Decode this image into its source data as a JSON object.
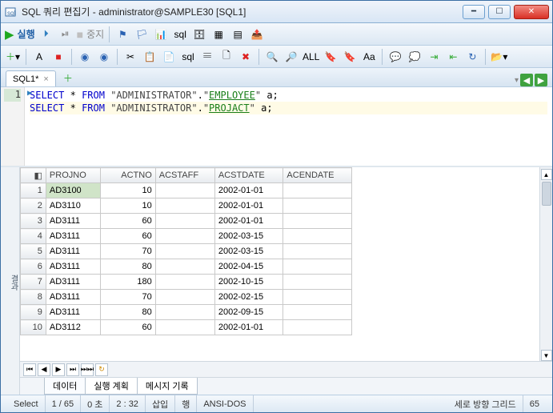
{
  "window": {
    "title": "SQL 쿼리 편집기 - administrator@SAMPLE30 [SQL1]"
  },
  "toolbar1": {
    "run_label": "실행",
    "stop_label": "중지"
  },
  "doc_tab": {
    "label": "SQL1*",
    "close": "×"
  },
  "editor": {
    "line1_num": "1",
    "sql": {
      "select": "SELECT",
      "star": "*",
      "from": "FROM",
      "schema": "\"ADMINISTRATOR\"",
      "t1": "EMPLOYEE",
      "t2": "PROJACT",
      "alias": "a",
      "semi": ";"
    }
  },
  "grid": {
    "side_label": "결과",
    "corner": "◧",
    "headers": [
      "PROJNO",
      "ACTNO",
      "ACSTAFF",
      "ACSTDATE",
      "ACENDATE"
    ],
    "rows": [
      {
        "n": "1",
        "projno": "AD3100",
        "actno": "10",
        "acstaff": "",
        "acstdate": "2002-01-01",
        "acendate": ""
      },
      {
        "n": "2",
        "projno": "AD3110",
        "actno": "10",
        "acstaff": "",
        "acstdate": "2002-01-01",
        "acendate": ""
      },
      {
        "n": "3",
        "projno": "AD3111",
        "actno": "60",
        "acstaff": "",
        "acstdate": "2002-01-01",
        "acendate": ""
      },
      {
        "n": "4",
        "projno": "AD3111",
        "actno": "60",
        "acstaff": "",
        "acstdate": "2002-03-15",
        "acendate": ""
      },
      {
        "n": "5",
        "projno": "AD3111",
        "actno": "70",
        "acstaff": "",
        "acstdate": "2002-03-15",
        "acendate": ""
      },
      {
        "n": "6",
        "projno": "AD3111",
        "actno": "80",
        "acstaff": "",
        "acstdate": "2002-04-15",
        "acendate": ""
      },
      {
        "n": "7",
        "projno": "AD3111",
        "actno": "180",
        "acstaff": "",
        "acstdate": "2002-10-15",
        "acendate": ""
      },
      {
        "n": "8",
        "projno": "AD3111",
        "actno": "70",
        "acstaff": "",
        "acstdate": "2002-02-15",
        "acendate": ""
      },
      {
        "n": "9",
        "projno": "AD3111",
        "actno": "80",
        "acstaff": "",
        "acstdate": "2002-09-15",
        "acendate": ""
      },
      {
        "n": "10",
        "projno": "AD3112",
        "actno": "60",
        "acstaff": "",
        "acstdate": "2002-01-01",
        "acendate": ""
      }
    ]
  },
  "bottom_tabs": {
    "t1": "데이터",
    "t2": "실행 계획",
    "t3": "메시지 기록"
  },
  "status": {
    "mode": "Select",
    "pos": "1 / 65",
    "time": "0 초",
    "linecol": "2 : 32",
    "ins": "삽입",
    "row": "행",
    "enc": "ANSI-DOS",
    "gridmode": "세로 방향 그리드",
    "rows": "65"
  },
  "icons": {
    "minimize": "━",
    "maximize": "☐",
    "close": "✕",
    "left": "◀",
    "right": "▶",
    "first": "⏮",
    "last": "⏭",
    "down": "▾",
    "play": "▶",
    "playbar": "⏵",
    "oneplay": "⏯",
    "stop": "■",
    "flag": "⚑",
    "gear": "⚙",
    "search": "🔍",
    "save": "💾",
    "copy": "📋",
    "cut": "✂",
    "paste": "📄",
    "new": "🗋",
    "x": "✖",
    "refresh": "↻",
    "plus": "＋",
    "box": "▦",
    "chart": "▤",
    "table": "𝄘"
  }
}
